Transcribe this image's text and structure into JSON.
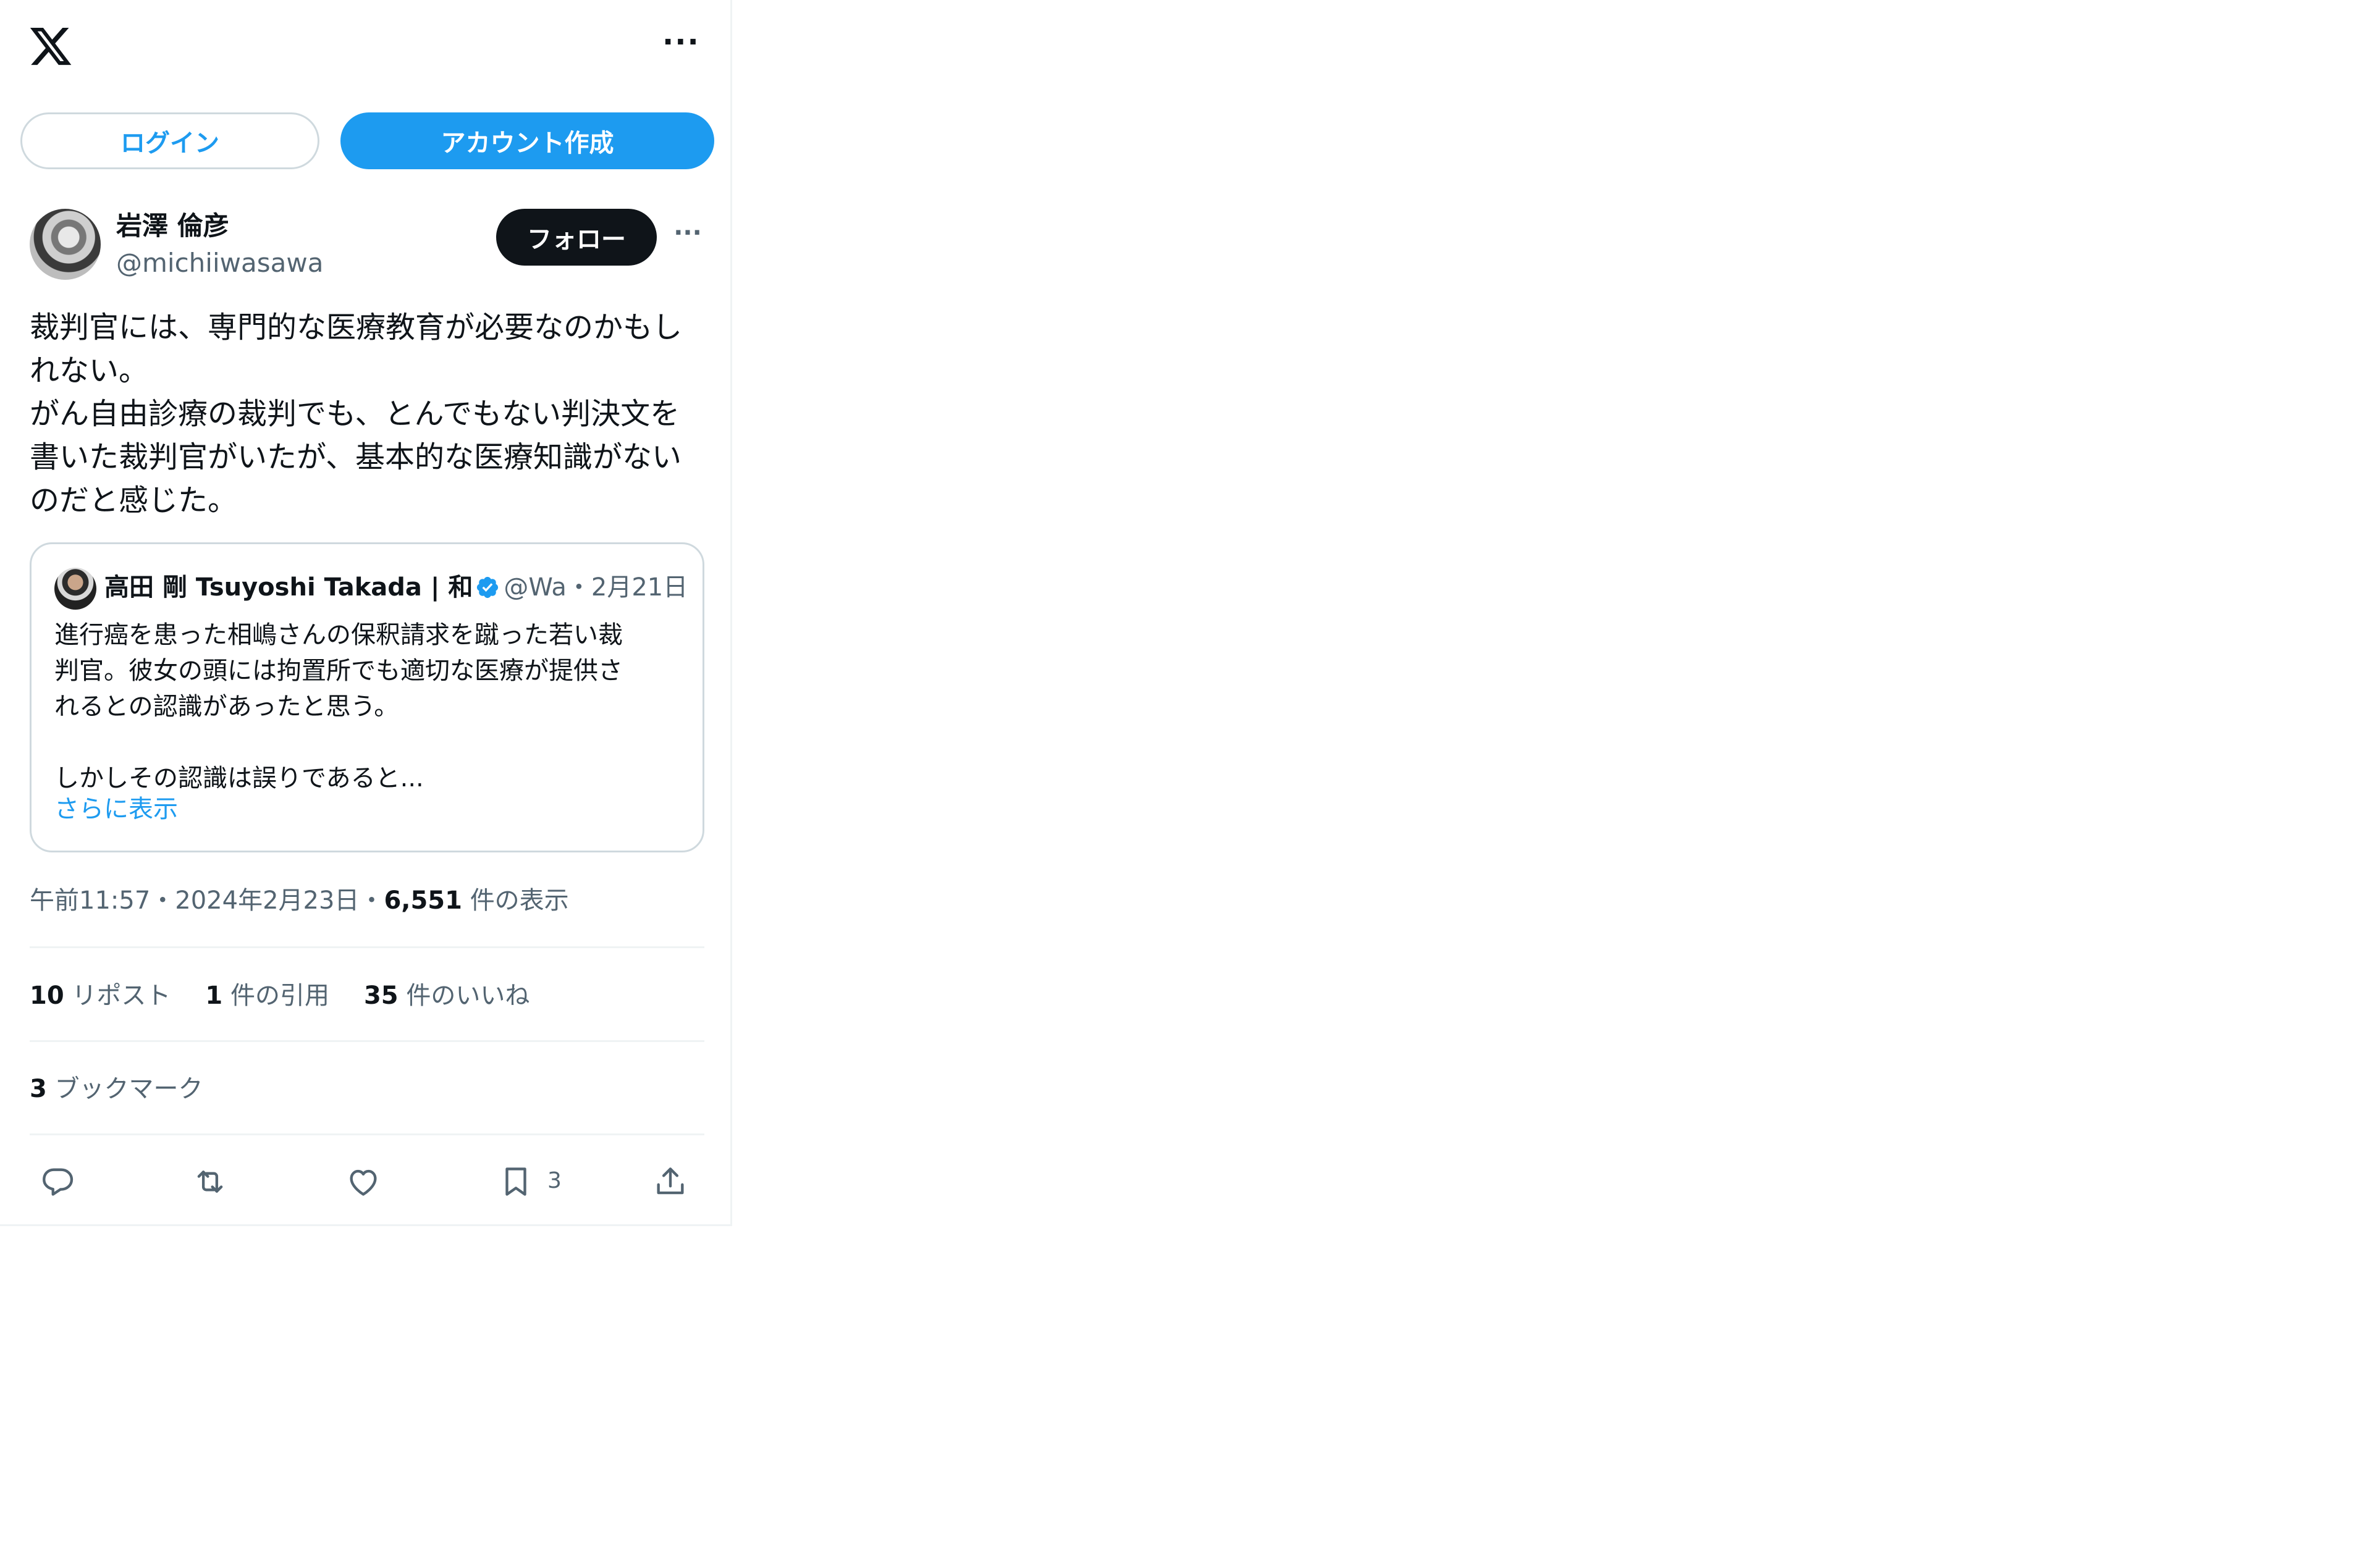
{
  "header": {
    "logo": "x-logo-icon",
    "more": "more-icon"
  },
  "auth": {
    "login_label": "ログイン",
    "create_account_label": "アカウント作成"
  },
  "post": {
    "author_name": "岩澤 倫彦",
    "author_handle": "@michiiwasawa",
    "follow_label": "フォロー",
    "text": "裁判官には、専門的な医療教育が必要なのかもし\nれない。\nがん自由診療の裁判でも、とんでもない判決文を\n書いた裁判官がいたが、基本的な医療知識がない\nのだと感じた。",
    "quote": {
      "author_name": "高田 剛 Tsuyoshi Takada | 和",
      "handle": "@Wa",
      "separator": "・",
      "date": "2月21日",
      "text": "進行癌を患った相嶋さんの保釈請求を蹴った若い裁\n判官。彼女の頭には拘置所でも適切な医療が提供さ\nれるとの認識があったと思う。\n\nしかしその認識は誤りであると...",
      "show_more": "さらに表示"
    },
    "time": "午前11:57",
    "dot": "・",
    "date": "2024年2月23日",
    "views_count": "6,551",
    "views_label": "件の表示",
    "reposts_count": "10",
    "reposts_label": "リポスト",
    "quotes_count": "1",
    "quotes_label": "件の引用",
    "likes_count": "35",
    "likes_label": "件のいいね",
    "bookmarks_count": "3",
    "bookmarks_label": "ブックマーク",
    "action_bookmark_count": "3"
  },
  "colors": {
    "accent": "#1d9bf0",
    "text": "#0f1419",
    "secondary": "#536471",
    "border": "#cfd9de"
  }
}
